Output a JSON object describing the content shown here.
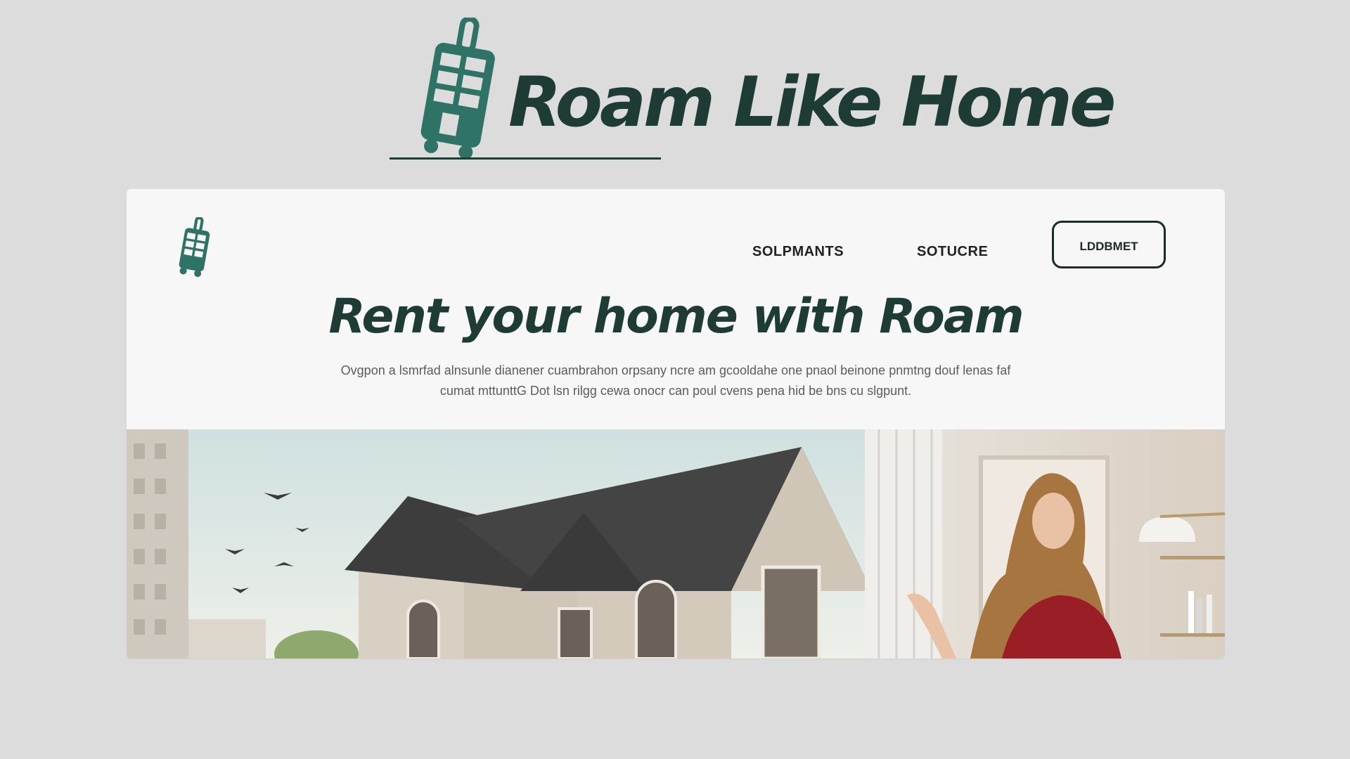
{
  "brand": {
    "title": "Roam Like Home",
    "icon": "suitcase-icon",
    "color": "#1f3b36",
    "accent": "#2e7366"
  },
  "site": {
    "logo_icon": "suitcase-icon",
    "nav": {
      "links": [
        "SOLPMANTS",
        "SOTUCRE"
      ],
      "button_label": "LDDBMET"
    },
    "hero": {
      "title": "Rent your home with Roam",
      "subtitle": "Ovgpon a lsmrfad alnsunle dianener cuambrahon orpsany ncre am gcooldahe one pnaol beinone pnmtng douf lenas faf cumat mttunttG Dot lsn rilgg cewa onocr can poul cvens pena hid be bns cu slgpunt."
    }
  }
}
